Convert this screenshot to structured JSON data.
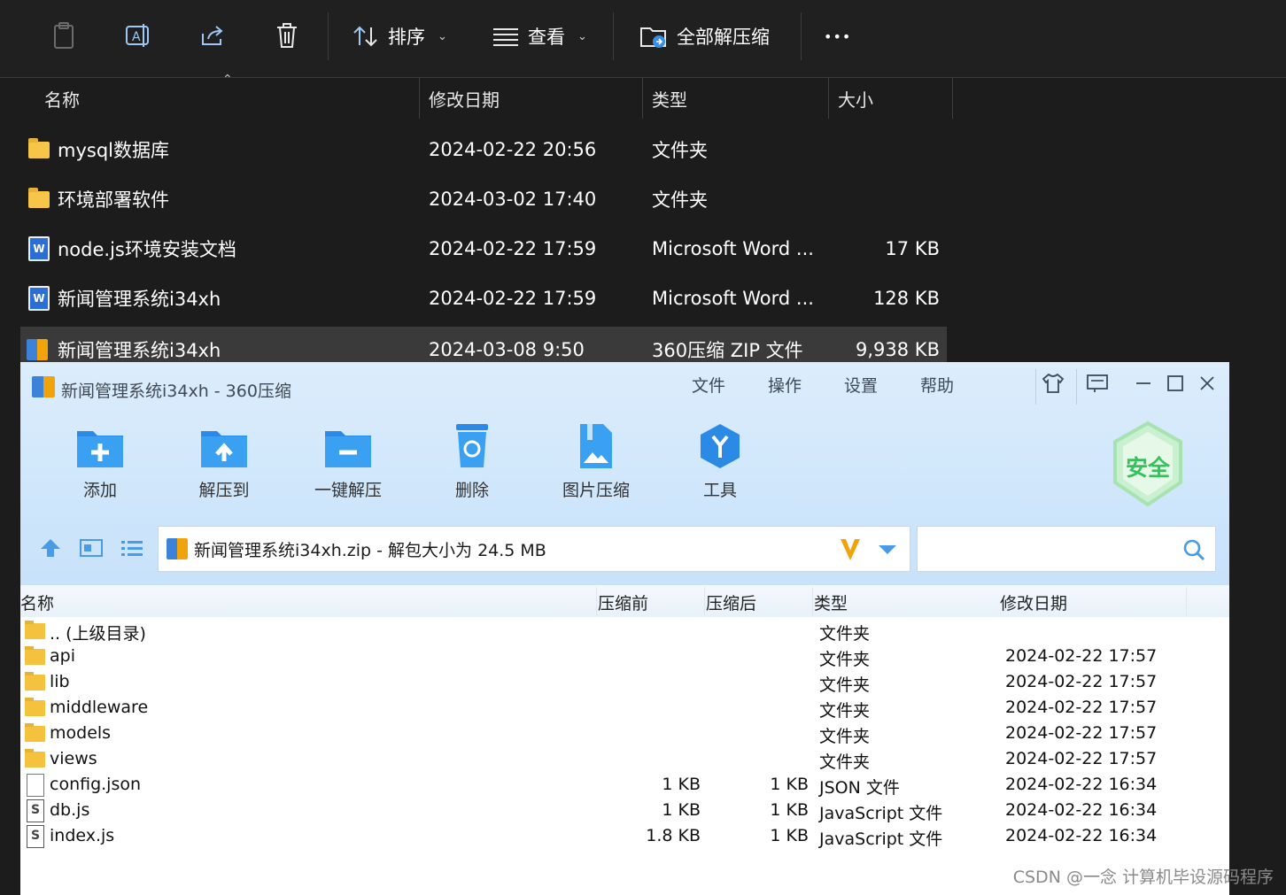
{
  "explorer": {
    "toolbar": {
      "sort_label": "排序",
      "view_label": "查看",
      "extract_all_label": "全部解压缩",
      "more_label": "•••"
    },
    "columns": {
      "name": "名称",
      "modified": "修改日期",
      "type": "类型",
      "size": "大小"
    },
    "rows": [
      {
        "name": "mysql数据库",
        "modified": "2024-02-22 20:56",
        "type": "文件夹",
        "size": "",
        "icon": "folder-icon"
      },
      {
        "name": "环境部署软件",
        "modified": "2024-03-02 17:40",
        "type": "文件夹",
        "size": "",
        "icon": "folder-icon"
      },
      {
        "name": "node.js环境安装文档",
        "modified": "2024-02-22 17:59",
        "type": "Microsoft Word ...",
        "size": "17 KB",
        "icon": "word-doc-icon"
      },
      {
        "name": "新闻管理系统i34xh",
        "modified": "2024-02-22 17:59",
        "type": "Microsoft Word ...",
        "size": "128 KB",
        "icon": "word-doc-icon"
      },
      {
        "name": "新闻管理系统i34xh",
        "modified": "2024-03-08 9:50",
        "type": "360压缩 ZIP 文件",
        "size": "9,938 KB",
        "icon": "zip-archive-icon"
      }
    ]
  },
  "zip360": {
    "title": "新闻管理系统i34xh - 360压缩",
    "menu": {
      "file": "文件",
      "operate": "操作",
      "settings": "设置",
      "help": "帮助"
    },
    "tools": {
      "add": "添加",
      "extract_to": "解压到",
      "one_click_extract": "一键解压",
      "delete": "删除",
      "image_compress": "图片压缩",
      "tools": "工具"
    },
    "badge": "安全",
    "address": "新闻管理系统i34xh.zip - 解包大小为 24.5 MB",
    "search_placeholder": "",
    "columns": {
      "name": "名称",
      "before": "压缩前",
      "after": "压缩后",
      "type": "类型",
      "modified": "修改日期"
    },
    "rows": [
      {
        "name": ".. (上级目录)",
        "before": "",
        "after": "",
        "type": "文件夹",
        "modified": "",
        "icon": "folder"
      },
      {
        "name": "api",
        "before": "",
        "after": "",
        "type": "文件夹",
        "modified": "2024-02-22 17:57",
        "icon": "folder"
      },
      {
        "name": "lib",
        "before": "",
        "after": "",
        "type": "文件夹",
        "modified": "2024-02-22 17:57",
        "icon": "folder"
      },
      {
        "name": "middleware",
        "before": "",
        "after": "",
        "type": "文件夹",
        "modified": "2024-02-22 17:57",
        "icon": "folder"
      },
      {
        "name": "models",
        "before": "",
        "after": "",
        "type": "文件夹",
        "modified": "2024-02-22 17:57",
        "icon": "folder"
      },
      {
        "name": "views",
        "before": "",
        "after": "",
        "type": "文件夹",
        "modified": "2024-02-22 17:57",
        "icon": "folder"
      },
      {
        "name": "config.json",
        "before": "1 KB",
        "after": "1 KB",
        "type": "JSON 文件",
        "modified": "2024-02-22 16:34",
        "icon": "file"
      },
      {
        "name": "db.js",
        "before": "1 KB",
        "after": "1 KB",
        "type": "JavaScript 文件",
        "modified": "2024-02-22 16:34",
        "icon": "js"
      },
      {
        "name": "index.js",
        "before": "1.8 KB",
        "after": "1 KB",
        "type": "JavaScript 文件",
        "modified": "2024-02-22 16:34",
        "icon": "js"
      }
    ]
  },
  "watermark": "CSDN @一念 计算机毕设源码程序"
}
